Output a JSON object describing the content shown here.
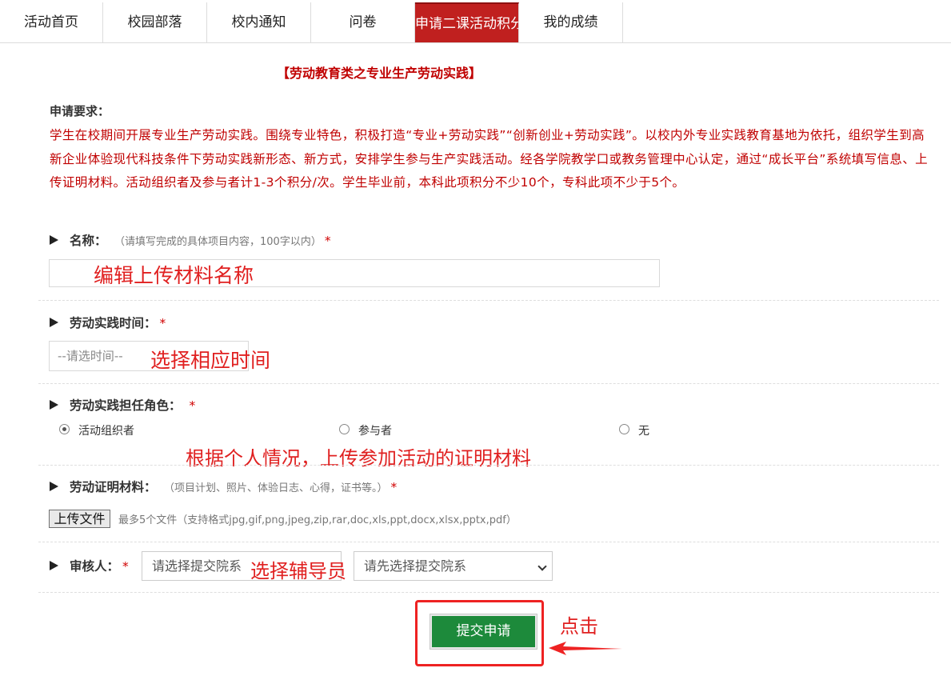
{
  "nav": {
    "tabs": [
      {
        "label": "活动首页"
      },
      {
        "label": "校园部落"
      },
      {
        "label": "校内通知"
      },
      {
        "label": "问卷"
      },
      {
        "label": "申请二课活动积分"
      },
      {
        "label": "我的成绩"
      }
    ],
    "active_tab": "申请二课活动积分"
  },
  "form": {
    "title": "【劳动教育类之专业生产劳动实践】",
    "requirements_label": "申请要求：",
    "requirements_text": "学生在校期间开展专业生产劳动实践。围绕专业特色，积极打造“专业+劳动实践”“创新创业+劳动实践”。以校内外专业实践教育基地为依托，组织学生到高新企业体验现代科技条件下劳动实践新形态、新方式，安排学生参与生产实践活动。经各学院教学口或教务管理中心认定，通过“成长平台”系统填写信息、上传证明材料。活动组织者及参与者计1-3个积分/次。学生毕业前，本科此项积分不少10个，专科此项不少于5个。",
    "name_label": "名称：",
    "name_hint": "（请填写完成的具体项目内容，100字以内）",
    "required_mark": "*",
    "time_label": "劳动实践时间：",
    "time_placeholder": "--请选时间--",
    "role_label": "劳动实践担任角色：",
    "roles": [
      {
        "label": "活动组织者",
        "checked": true
      },
      {
        "label": "参与者",
        "checked": false
      },
      {
        "label": "无",
        "checked": false
      }
    ],
    "proof_label": "劳动证明材料：",
    "proof_hint": "（项目计划、照片、体验日志、心得，证书等。）",
    "upload_button": "上传文件",
    "upload_hint": "最多5个文件（支持格式jpg,gif,png,jpeg,zip,rar,doc,xls,ppt,docx,xlsx,pptx,pdf）",
    "reviewer_label": "审核人：",
    "reviewer_select_1": "请选择提交院系",
    "reviewer_select_2": "请先选择提交院系",
    "submit_button": "提交申请"
  },
  "annotations": {
    "name_note": "编辑上传材料名称",
    "time_note": "选择相应时间",
    "proof_note": "根据个人情况，上传参加活动的证明材料",
    "reviewer_note": "选择辅导员",
    "click_note": "点击"
  },
  "colors": {
    "accent_red": "#c00000",
    "active_tab_bg": "#c0201f",
    "submit_green": "#1d8a3b",
    "annotation_red": "#e02020"
  }
}
